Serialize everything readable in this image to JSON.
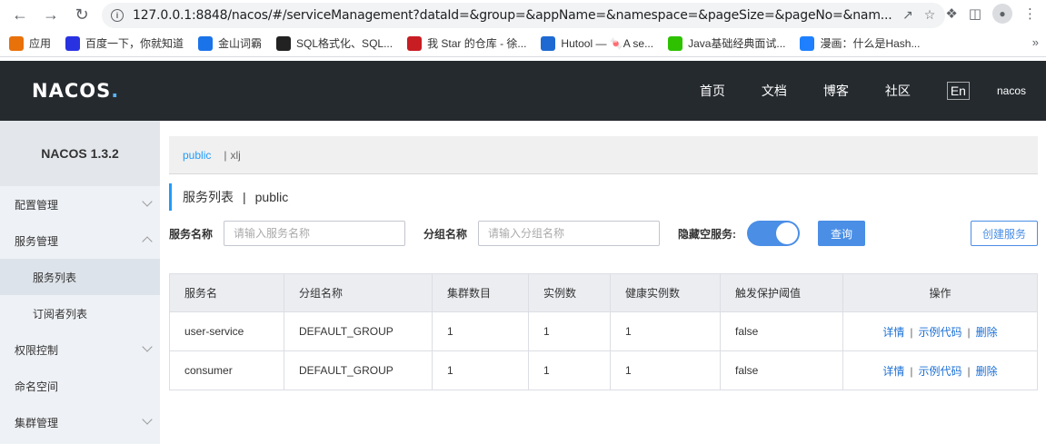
{
  "browser": {
    "url": "127.0.0.1:8848/nacos/#/serviceManagement?dataId=&group=&appName=&namespace=&pageSize=&pageNo=&nam..."
  },
  "bookmarks": [
    {
      "label": "应用",
      "icon": "apps-grid-icon",
      "color": "#e8710a"
    },
    {
      "label": "百度一下，你就知道",
      "icon": "baidu-paw-icon",
      "color": "#2932e1"
    },
    {
      "label": "金山词霸",
      "icon": "iciba-icon",
      "color": "#1a73e8"
    },
    {
      "label": "SQL格式化、SQL...",
      "icon": "sql-tool-icon",
      "color": "#222222"
    },
    {
      "label": "我 Star 的仓库 - 徐...",
      "icon": "gitee-icon",
      "color": "#c71d23"
    },
    {
      "label": "Hutool — 🍬A se...",
      "icon": "hutool-icon",
      "color": "#1e6ad2"
    },
    {
      "label": "Java基础经典面试...",
      "icon": "wechat-icon",
      "color": "#2dc100"
    },
    {
      "label": "漫画：什么是Hash...",
      "icon": "juejin-icon",
      "color": "#1e80ff"
    }
  ],
  "header": {
    "logo": "NACOS",
    "logo_dot": ".",
    "nav": [
      "首页",
      "文档",
      "博客",
      "社区"
    ],
    "lang": "En",
    "user": "nacos"
  },
  "sidebar": {
    "version": "NACOS 1.3.2",
    "items": [
      {
        "label": "配置管理",
        "expandable": true,
        "expanded": false
      },
      {
        "label": "服务管理",
        "expandable": true,
        "expanded": true
      },
      {
        "label": "服务列表",
        "sub": true,
        "active": true
      },
      {
        "label": "订阅者列表",
        "sub": true
      },
      {
        "label": "权限控制",
        "expandable": true,
        "expanded": false
      },
      {
        "label": "命名空间"
      },
      {
        "label": "集群管理",
        "expandable": true,
        "expanded": false
      }
    ]
  },
  "namespace": {
    "active": "public",
    "separator": "|",
    "other": "xlj"
  },
  "title": {
    "main": "服务列表",
    "sep": "|",
    "ns": "public"
  },
  "filters": {
    "service_label": "服务名称",
    "service_placeholder": "请输入服务名称",
    "group_label": "分组名称",
    "group_placeholder": "请输入分组名称",
    "hide_empty_label": "隐藏空服务:",
    "hide_empty_on": true,
    "query_button": "查询",
    "create_button": "创建服务"
  },
  "table": {
    "headers": [
      "服务名",
      "分组名称",
      "集群数目",
      "实例数",
      "健康实例数",
      "触发保护阈值",
      "操作"
    ],
    "rows": [
      {
        "name": "user-service",
        "group": "DEFAULT_GROUP",
        "clusters": "1",
        "instances": "1",
        "healthy": "1",
        "threshold": "false"
      },
      {
        "name": "consumer",
        "group": "DEFAULT_GROUP",
        "clusters": "1",
        "instances": "1",
        "healthy": "1",
        "threshold": "false"
      }
    ],
    "actions": {
      "detail": "详情",
      "sample": "示例代码",
      "delete": "删除",
      "sep": "|"
    }
  }
}
